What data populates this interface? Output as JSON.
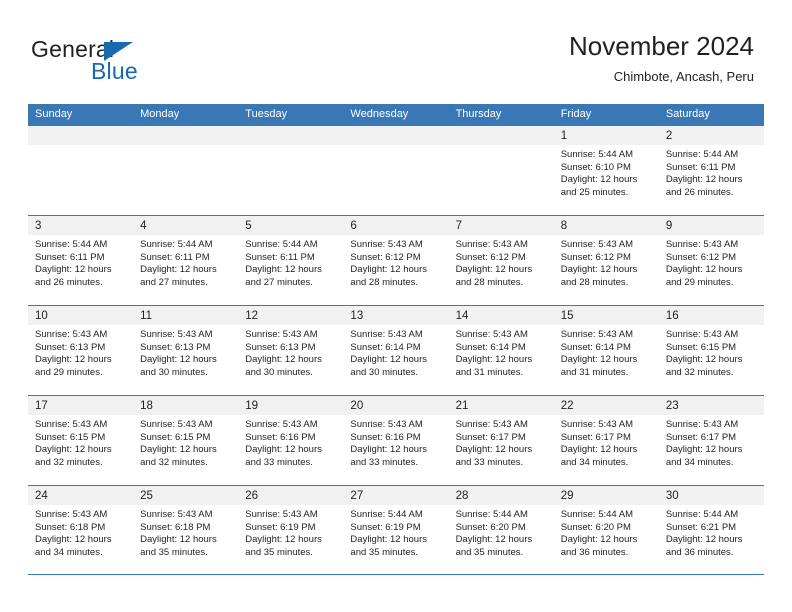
{
  "brand": {
    "name_part1": "General",
    "name_part2": "Blue",
    "triangle_color": "#1769b0",
    "text_color": "#231f20"
  },
  "header": {
    "title": "November 2024",
    "location": "Chimbote, Ancash, Peru"
  },
  "theme": {
    "header_blue": "#3a78b5",
    "day_strip_gray": "#f1f1f1",
    "text": "#231f20",
    "background": "#ffffff"
  },
  "weekdays": [
    "Sunday",
    "Monday",
    "Tuesday",
    "Wednesday",
    "Thursday",
    "Friday",
    "Saturday"
  ],
  "weeks": [
    [
      {
        "day": "",
        "empty": true
      },
      {
        "day": "",
        "empty": true
      },
      {
        "day": "",
        "empty": true
      },
      {
        "day": "",
        "empty": true
      },
      {
        "day": "",
        "empty": true
      },
      {
        "day": "1",
        "sunrise": "Sunrise: 5:44 AM",
        "sunset": "Sunset: 6:10 PM",
        "daylight1": "Daylight: 12 hours",
        "daylight2": "and 25 minutes."
      },
      {
        "day": "2",
        "sunrise": "Sunrise: 5:44 AM",
        "sunset": "Sunset: 6:11 PM",
        "daylight1": "Daylight: 12 hours",
        "daylight2": "and 26 minutes."
      }
    ],
    [
      {
        "day": "3",
        "sunrise": "Sunrise: 5:44 AM",
        "sunset": "Sunset: 6:11 PM",
        "daylight1": "Daylight: 12 hours",
        "daylight2": "and 26 minutes."
      },
      {
        "day": "4",
        "sunrise": "Sunrise: 5:44 AM",
        "sunset": "Sunset: 6:11 PM",
        "daylight1": "Daylight: 12 hours",
        "daylight2": "and 27 minutes."
      },
      {
        "day": "5",
        "sunrise": "Sunrise: 5:44 AM",
        "sunset": "Sunset: 6:11 PM",
        "daylight1": "Daylight: 12 hours",
        "daylight2": "and 27 minutes."
      },
      {
        "day": "6",
        "sunrise": "Sunrise: 5:43 AM",
        "sunset": "Sunset: 6:12 PM",
        "daylight1": "Daylight: 12 hours",
        "daylight2": "and 28 minutes."
      },
      {
        "day": "7",
        "sunrise": "Sunrise: 5:43 AM",
        "sunset": "Sunset: 6:12 PM",
        "daylight1": "Daylight: 12 hours",
        "daylight2": "and 28 minutes."
      },
      {
        "day": "8",
        "sunrise": "Sunrise: 5:43 AM",
        "sunset": "Sunset: 6:12 PM",
        "daylight1": "Daylight: 12 hours",
        "daylight2": "and 28 minutes."
      },
      {
        "day": "9",
        "sunrise": "Sunrise: 5:43 AM",
        "sunset": "Sunset: 6:12 PM",
        "daylight1": "Daylight: 12 hours",
        "daylight2": "and 29 minutes."
      }
    ],
    [
      {
        "day": "10",
        "sunrise": "Sunrise: 5:43 AM",
        "sunset": "Sunset: 6:13 PM",
        "daylight1": "Daylight: 12 hours",
        "daylight2": "and 29 minutes."
      },
      {
        "day": "11",
        "sunrise": "Sunrise: 5:43 AM",
        "sunset": "Sunset: 6:13 PM",
        "daylight1": "Daylight: 12 hours",
        "daylight2": "and 30 minutes."
      },
      {
        "day": "12",
        "sunrise": "Sunrise: 5:43 AM",
        "sunset": "Sunset: 6:13 PM",
        "daylight1": "Daylight: 12 hours",
        "daylight2": "and 30 minutes."
      },
      {
        "day": "13",
        "sunrise": "Sunrise: 5:43 AM",
        "sunset": "Sunset: 6:14 PM",
        "daylight1": "Daylight: 12 hours",
        "daylight2": "and 30 minutes."
      },
      {
        "day": "14",
        "sunrise": "Sunrise: 5:43 AM",
        "sunset": "Sunset: 6:14 PM",
        "daylight1": "Daylight: 12 hours",
        "daylight2": "and 31 minutes."
      },
      {
        "day": "15",
        "sunrise": "Sunrise: 5:43 AM",
        "sunset": "Sunset: 6:14 PM",
        "daylight1": "Daylight: 12 hours",
        "daylight2": "and 31 minutes."
      },
      {
        "day": "16",
        "sunrise": "Sunrise: 5:43 AM",
        "sunset": "Sunset: 6:15 PM",
        "daylight1": "Daylight: 12 hours",
        "daylight2": "and 32 minutes."
      }
    ],
    [
      {
        "day": "17",
        "sunrise": "Sunrise: 5:43 AM",
        "sunset": "Sunset: 6:15 PM",
        "daylight1": "Daylight: 12 hours",
        "daylight2": "and 32 minutes."
      },
      {
        "day": "18",
        "sunrise": "Sunrise: 5:43 AM",
        "sunset": "Sunset: 6:15 PM",
        "daylight1": "Daylight: 12 hours",
        "daylight2": "and 32 minutes."
      },
      {
        "day": "19",
        "sunrise": "Sunrise: 5:43 AM",
        "sunset": "Sunset: 6:16 PM",
        "daylight1": "Daylight: 12 hours",
        "daylight2": "and 33 minutes."
      },
      {
        "day": "20",
        "sunrise": "Sunrise: 5:43 AM",
        "sunset": "Sunset: 6:16 PM",
        "daylight1": "Daylight: 12 hours",
        "daylight2": "and 33 minutes."
      },
      {
        "day": "21",
        "sunrise": "Sunrise: 5:43 AM",
        "sunset": "Sunset: 6:17 PM",
        "daylight1": "Daylight: 12 hours",
        "daylight2": "and 33 minutes."
      },
      {
        "day": "22",
        "sunrise": "Sunrise: 5:43 AM",
        "sunset": "Sunset: 6:17 PM",
        "daylight1": "Daylight: 12 hours",
        "daylight2": "and 34 minutes."
      },
      {
        "day": "23",
        "sunrise": "Sunrise: 5:43 AM",
        "sunset": "Sunset: 6:17 PM",
        "daylight1": "Daylight: 12 hours",
        "daylight2": "and 34 minutes."
      }
    ],
    [
      {
        "day": "24",
        "sunrise": "Sunrise: 5:43 AM",
        "sunset": "Sunset: 6:18 PM",
        "daylight1": "Daylight: 12 hours",
        "daylight2": "and 34 minutes."
      },
      {
        "day": "25",
        "sunrise": "Sunrise: 5:43 AM",
        "sunset": "Sunset: 6:18 PM",
        "daylight1": "Daylight: 12 hours",
        "daylight2": "and 35 minutes."
      },
      {
        "day": "26",
        "sunrise": "Sunrise: 5:43 AM",
        "sunset": "Sunset: 6:19 PM",
        "daylight1": "Daylight: 12 hours",
        "daylight2": "and 35 minutes."
      },
      {
        "day": "27",
        "sunrise": "Sunrise: 5:44 AM",
        "sunset": "Sunset: 6:19 PM",
        "daylight1": "Daylight: 12 hours",
        "daylight2": "and 35 minutes."
      },
      {
        "day": "28",
        "sunrise": "Sunrise: 5:44 AM",
        "sunset": "Sunset: 6:20 PM",
        "daylight1": "Daylight: 12 hours",
        "daylight2": "and 35 minutes."
      },
      {
        "day": "29",
        "sunrise": "Sunrise: 5:44 AM",
        "sunset": "Sunset: 6:20 PM",
        "daylight1": "Daylight: 12 hours",
        "daylight2": "and 36 minutes."
      },
      {
        "day": "30",
        "sunrise": "Sunrise: 5:44 AM",
        "sunset": "Sunset: 6:21 PM",
        "daylight1": "Daylight: 12 hours",
        "daylight2": "and 36 minutes."
      }
    ]
  ]
}
